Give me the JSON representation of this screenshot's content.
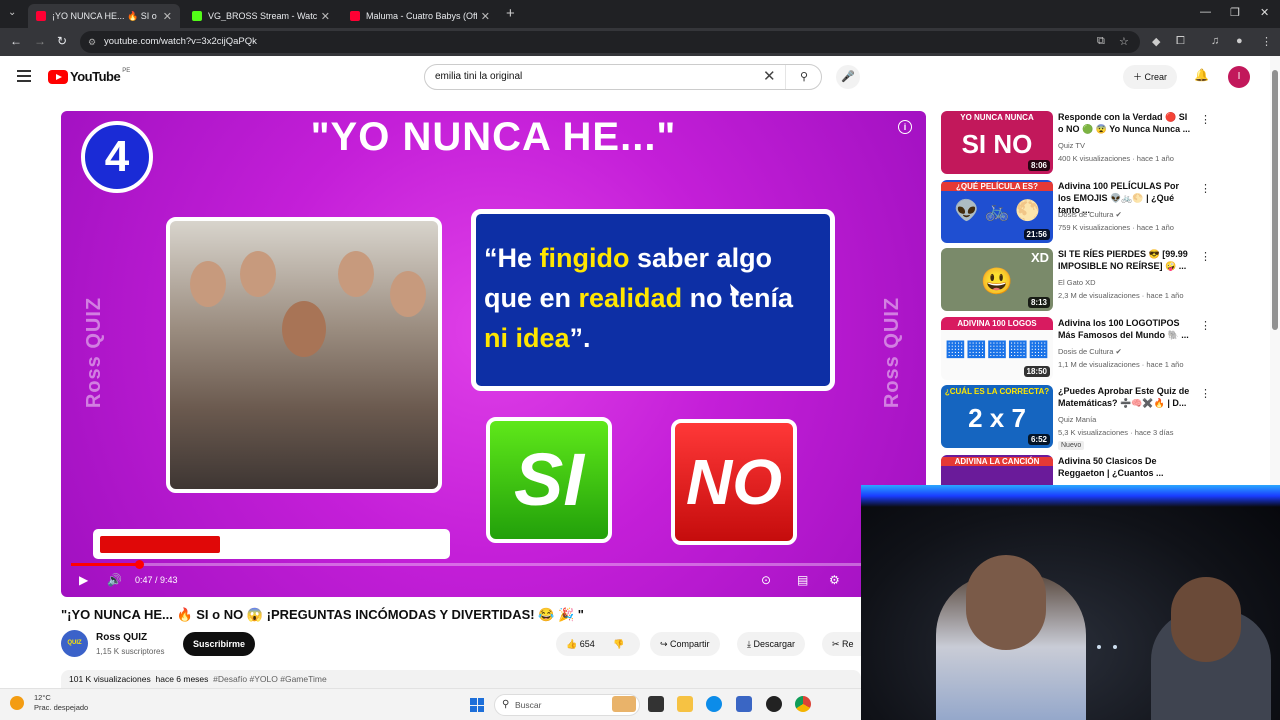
{
  "browser": {
    "tabs": [
      {
        "title": "¡YO NUNCA HE... 🔥 SI o NO 😱",
        "favicon_color": "#ff0033",
        "active": true
      },
      {
        "title": "VG_BROSS Stream - Watch Live",
        "favicon_color": "#53fc18",
        "active": false
      },
      {
        "title": "Maluma - Cuatro Babys (Officia",
        "favicon_color": "#ff0033",
        "active": false
      }
    ],
    "url": "youtube.com/watch?v=3x2cijQaPQk",
    "new_tab": "+",
    "close_glyph": "✕"
  },
  "yt_header": {
    "logo_text": "YouTube",
    "region": "PE",
    "search_value": "emilia tini la original",
    "create_label": "Crear",
    "avatar_letter": "I"
  },
  "player": {
    "question_number": "4",
    "title": "\"YO NUNCA HE...\"",
    "watermark": "Ross QUIZ",
    "question": {
      "p1": "“He ",
      "h1": "fingido",
      "p2": " saber algo que en ",
      "h2": "realidad",
      "p3": " no tenía ",
      "h3": "ni idea",
      "p4": "”."
    },
    "si_label": "SI",
    "no_label": "NO",
    "timer_fraction": 0.35,
    "time_current": "0:47",
    "time_total": "9:43",
    "time_display": "0:47 / 9:43",
    "progress_fraction": 0.0806
  },
  "video": {
    "title": "\"¡YO NUNCA HE... 🔥 SI o NO 😱 ¡PREGUNTAS INCÓMODAS Y DIVERTIDAS! 😂 🎉 \"",
    "channel": "Ross QUIZ",
    "channel_avatar_text": "QUIZ",
    "subscribers": "1,15 K suscriptores",
    "subscribe_label": "Suscribirme",
    "likes": "654",
    "share_label": "Compartir",
    "download_label": "Descargar",
    "remix_label": "Re",
    "views": "101 K visualizaciones",
    "age": "hace 6 meses",
    "tags": "#Desafío #YOLO #GameTime"
  },
  "recommendations": [
    {
      "title": "Responde con la Verdad 🔴 SI o NO 🟢 😨 Yo Nunca Nunca ...",
      "channel": "Quiz TV",
      "meta": "400 K visualizaciones · hace 1 año",
      "duration": "8:06",
      "thumb_text": "YO NUNCA NUNCA",
      "thumb_big": "SI  NO",
      "thumb_color": "#c2185b"
    },
    {
      "title": "Adivina 100 PELÍCULAS Por los EMOJIS 👽🚲🌕 | ¿Qué tanto ...",
      "channel": "Dosis de Cultura ✔",
      "meta": "759 K visualizaciones · hace 1 año",
      "duration": "21:56",
      "thumb_text": "¿QUÉ PELÍCULA ES?",
      "thumb_big": "👽 🚲 🌕",
      "thumb_color": "#1f4fd1"
    },
    {
      "title": "SI TE RÍES PIERDES 😎 [99.99 IMPOSIBLE NO REÍRSE] 🤪 ...",
      "channel": "El Gato XD",
      "meta": "2,3 M de visualizaciones · hace 1 año",
      "duration": "8:13",
      "thumb_text": "XD",
      "thumb_big": "😃",
      "thumb_color": "#7a8a6a"
    },
    {
      "title": "Adivina los 100 LOGOTIPOS Más Famosos del Mundo 🐘 ...",
      "channel": "Dosis de Cultura ✔",
      "meta": "1,1 M de visualizaciones · hace 1 año",
      "duration": "18:50",
      "thumb_text": "ADIVINA 100 LOGOS",
      "thumb_big": "▦▦▦▦▦",
      "thumb_color": "#d81b60"
    },
    {
      "title": "¿Puedes Aprobar Este Quiz de Matemáticas? ➗🧠✖️🔥 | D...",
      "channel": "Quiz Manía",
      "meta": "5,3 K visualizaciones · hace 3 días",
      "duration": "6:52",
      "thumb_text": "¿CUÁL ES LA CORRECTA?",
      "thumb_big": "2 x 7",
      "thumb_color": "#1565c0",
      "badge": "Nuevo"
    },
    {
      "title": "Adivina 50 Clasicos De Reggaeton | ¿Cuantos ...",
      "channel": "",
      "meta": "",
      "duration": "",
      "thumb_text": "ADIVINA LA CANCIÓN",
      "thumb_big": "",
      "thumb_color": "#6a1b9a"
    }
  ],
  "taskbar": {
    "temperature": "12°C",
    "weather": "Prac. despejado",
    "search_placeholder": "Buscar"
  }
}
